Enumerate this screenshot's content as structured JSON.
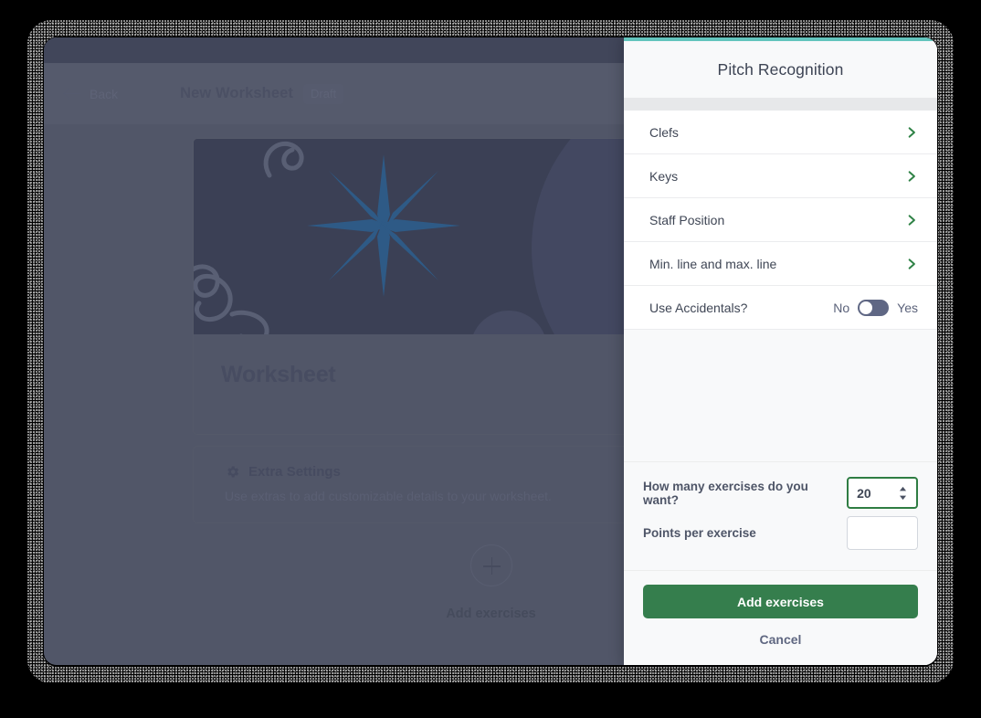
{
  "app": {
    "back_label": "Back",
    "title": "New Worksheet",
    "status_badge": "Draft",
    "worksheet_card_title": "Worksheet",
    "extra_settings": {
      "title": "Extra Settings",
      "subtitle": "Use extras to add customizable details to your worksheet."
    },
    "add_exercises": {
      "label": "Add exercises"
    }
  },
  "panel": {
    "title": "Pitch Recognition",
    "accent_top_color": "#63c4bd",
    "chevron_color": "#2f8246",
    "options": [
      {
        "label": "Clefs",
        "type": "navigation"
      },
      {
        "label": "Keys",
        "type": "navigation"
      },
      {
        "label": "Staff Position",
        "type": "navigation"
      },
      {
        "label": "Min. line and max. line",
        "type": "navigation"
      }
    ],
    "toggle_option": {
      "label": "Use Accidentals?",
      "off_label": "No",
      "on_label": "Yes",
      "value": "No"
    },
    "form": {
      "exercises_label": "How many exercises do you want?",
      "exercises_value": "20",
      "points_label": "Points per exercise",
      "points_value": "",
      "points_placeholder": ""
    },
    "actions": {
      "primary_label": "Add exercises",
      "primary_color": "#357e4d",
      "cancel_label": "Cancel"
    }
  }
}
